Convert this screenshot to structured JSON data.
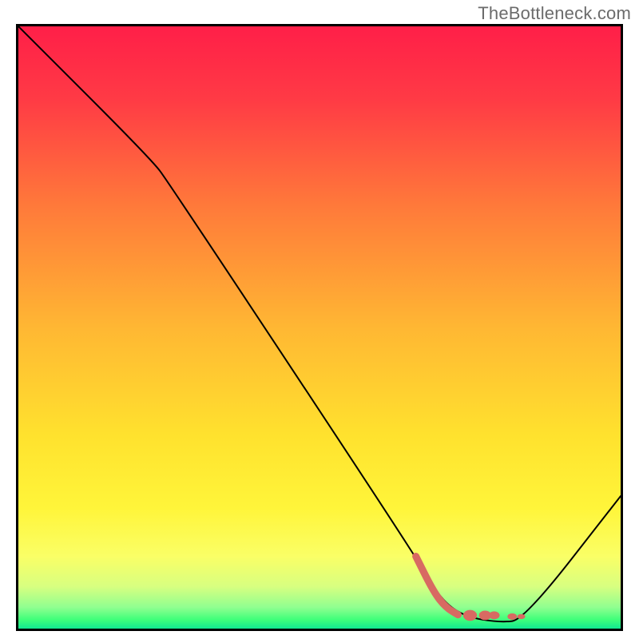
{
  "attribution": "TheBottleneck.com",
  "chart_data": {
    "type": "line",
    "title": "",
    "xlabel": "",
    "ylabel": "",
    "xlim": [
      0,
      100
    ],
    "ylim": [
      0,
      100
    ],
    "grid": false,
    "series": [
      {
        "name": "curve",
        "style": "solid-thin-black",
        "points": [
          {
            "x": 0,
            "y": 100
          },
          {
            "x": 22,
            "y": 78
          },
          {
            "x": 25,
            "y": 74
          },
          {
            "x": 66,
            "y": 12
          },
          {
            "x": 70,
            "y": 5
          },
          {
            "x": 74,
            "y": 2
          },
          {
            "x": 80,
            "y": 1
          },
          {
            "x": 84,
            "y": 1.5
          },
          {
            "x": 100,
            "y": 22
          }
        ]
      },
      {
        "name": "highlight",
        "style": "thick-dashed-coral",
        "points": [
          {
            "x": 66,
            "y": 12
          },
          {
            "x": 69,
            "y": 6
          },
          {
            "x": 71,
            "y": 3.5
          },
          {
            "x": 73,
            "y": 2.3
          },
          {
            "x": 75,
            "y": 2.2
          },
          {
            "x": 77.5,
            "y": 2.2
          },
          {
            "x": 79,
            "y": 2.2
          },
          {
            "x": 82,
            "y": 2.0
          },
          {
            "x": 83.5,
            "y": 2.0
          }
        ]
      }
    ],
    "gradient_stops": [
      {
        "pos": 0.0,
        "color": "#ff1f48"
      },
      {
        "pos": 0.12,
        "color": "#ff3a45"
      },
      {
        "pos": 0.3,
        "color": "#ff7a3a"
      },
      {
        "pos": 0.5,
        "color": "#ffb733"
      },
      {
        "pos": 0.68,
        "color": "#ffe22e"
      },
      {
        "pos": 0.8,
        "color": "#fff53a"
      },
      {
        "pos": 0.88,
        "color": "#faff66"
      },
      {
        "pos": 0.93,
        "color": "#d8ff80"
      },
      {
        "pos": 0.965,
        "color": "#8fff90"
      },
      {
        "pos": 0.985,
        "color": "#3fff7a"
      },
      {
        "pos": 1.0,
        "color": "#11e892"
      }
    ],
    "colors": {
      "curve": "#000000",
      "highlight": "#d86a62"
    }
  }
}
